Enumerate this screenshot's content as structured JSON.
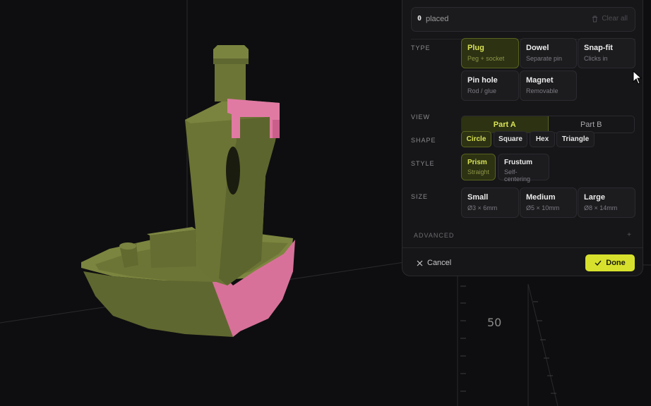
{
  "viewport": {
    "ruler_value": "50"
  },
  "placed": {
    "count": "0",
    "label": "placed",
    "clear_all": "Clear all"
  },
  "type": {
    "label": "TYPE",
    "options": [
      {
        "title": "Plug",
        "subtitle": "Peg + socket",
        "active": true
      },
      {
        "title": "Dowel",
        "subtitle": "Separate pin"
      },
      {
        "title": "Snap-fit",
        "subtitle": "Clicks in"
      },
      {
        "title": "Pin hole",
        "subtitle": "Rod / glue"
      },
      {
        "title": "Magnet",
        "subtitle": "Removable"
      }
    ]
  },
  "view": {
    "label": "VIEW",
    "options": [
      "Part A",
      "Part B"
    ],
    "selected": "Part A"
  },
  "shape": {
    "label": "SHAPE",
    "options": [
      "Circle",
      "Square",
      "Hex",
      "Triangle"
    ],
    "selected": "Circle"
  },
  "style": {
    "label": "STYLE",
    "options": [
      {
        "title": "Prism",
        "subtitle": "Straight",
        "active": true
      },
      {
        "title": "Frustum",
        "subtitle": "Self-centering"
      }
    ]
  },
  "size": {
    "label": "SIZE",
    "options": [
      {
        "title": "Small",
        "subtitle": "Ø3 × 6mm"
      },
      {
        "title": "Medium",
        "subtitle": "Ø5 × 10mm"
      },
      {
        "title": "Large",
        "subtitle": "Ø8 × 14mm"
      }
    ]
  },
  "advanced": {
    "label": "ADVANCED",
    "toggle": "+"
  },
  "footer": {
    "cancel": "Cancel",
    "done": "Done"
  },
  "colors": {
    "accent": "#d7e12d",
    "model": "#6b7336",
    "cut_face": "#e07aa3",
    "background": "#0e0e10"
  }
}
